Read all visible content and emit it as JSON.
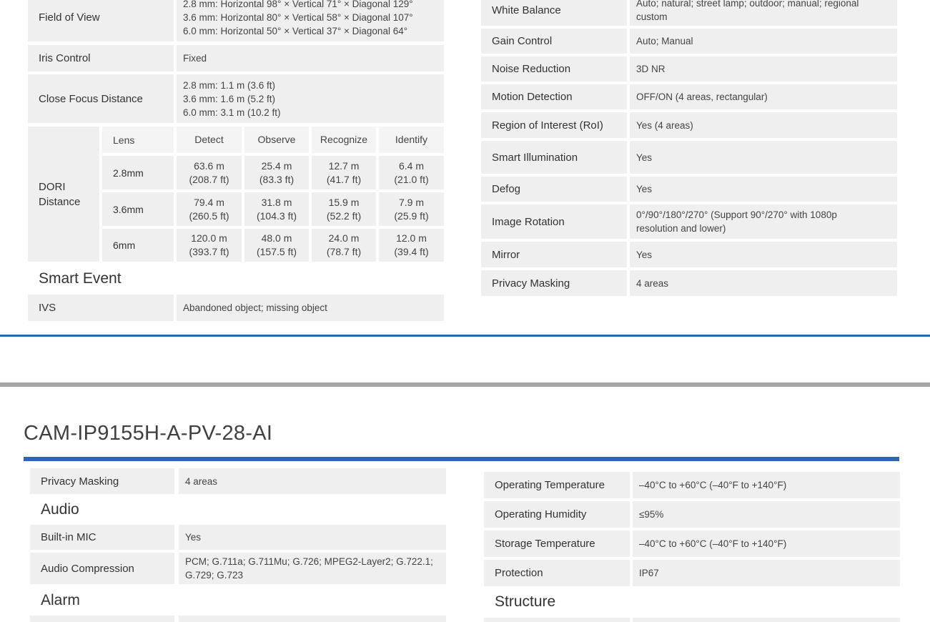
{
  "colors": {
    "accent_blue": "#2c67ad",
    "divider_gray": "#a6a6a6",
    "cell_bg": "#efefef"
  },
  "top_left": {
    "field_of_view": {
      "label": "Field of View",
      "value": "2.8 mm: Horizontal 98° × Vertical 71° × Diagonal 129°\n3.6 mm: Horizontal 80° × Vertical 58° × Diagonal 107°\n6.0 mm: Horizontal 50° × Vertical 37° × Diagonal 64°"
    },
    "iris_control": {
      "label": "Iris Control",
      "value": "Fixed"
    },
    "close_focus": {
      "label": "Close Focus Distance",
      "value": "2.8 mm: 1.1 m (3.6 ft)\n3.6 mm: 1.6 m (5.2 ft)\n6.0 mm: 3.1 m (10.2 ft)"
    },
    "dori": {
      "label": "DORI\nDistance",
      "headers": [
        "Lens",
        "Detect",
        "Observe",
        "Recognize",
        "Identify"
      ],
      "rows": [
        {
          "lens": "2.8mm",
          "cells": [
            "63.6 m\n(208.7 ft)",
            "25.4 m\n(83.3 ft)",
            "12.7 m\n(41.7 ft)",
            "6.4 m\n(21.0 ft)"
          ]
        },
        {
          "lens": "3.6mm",
          "cells": [
            "79.4 m\n(260.5 ft)",
            "31.8 m\n(104.3 ft)",
            "15.9 m\n(52.2 ft)",
            "7.9 m\n(25.9 ft)"
          ]
        },
        {
          "lens": "6mm",
          "cells": [
            "120.0 m\n(393.7 ft)",
            "48.0 m\n(157.5 ft)",
            "24.0 m\n(78.7 ft)",
            "12.0 m\n(39.4 ft)"
          ]
        }
      ]
    },
    "smart_event_title": "Smart Event",
    "ivs": {
      "label": "IVS",
      "value": "Abandoned object; missing object"
    }
  },
  "top_right": {
    "rows": [
      {
        "label": "White Balance",
        "value": "Auto; natural; street lamp; outdoor; manual; regional\ncustom"
      },
      {
        "label": "Gain Control",
        "value": "Auto; Manual"
      },
      {
        "label": "Noise Reduction",
        "value": "3D NR"
      },
      {
        "label": "Motion Detection",
        "value": "OFF/ON (4 areas, rectangular)"
      },
      {
        "label": "Region of Interest (RoI)",
        "value": "Yes (4 areas)"
      },
      {
        "label": "Smart Illumination",
        "value": "Yes"
      },
      {
        "label": "Defog",
        "value": "Yes"
      },
      {
        "label": "Image Rotation",
        "value": "0°/90°/180°/270° (Support 90°/270° with 1080p\nresolution and lower)"
      },
      {
        "label": "Mirror",
        "value": "Yes"
      },
      {
        "label": "Privacy Masking",
        "value": "4 areas"
      }
    ]
  },
  "bottom": {
    "model_title": "CAM-IP9155H-A-PV-28-AI",
    "left": {
      "privacy_masking": {
        "label": "Privacy Masking",
        "value": "4 areas"
      },
      "audio_title": "Audio",
      "builtin_mic": {
        "label": "Built-in MIC",
        "value": "Yes"
      },
      "audio_compression": {
        "label": "Audio Compression",
        "value": "PCM; G.711a; G.711Mu; G.726; MPEG2-Layer2; G.722.1;\nG.729; G.723"
      },
      "alarm_title": "Alarm"
    },
    "right": {
      "rows": [
        {
          "label": "Operating Temperature",
          "value": "–40°C to +60°C (–40°F to +140°F)"
        },
        {
          "label": "Operating Humidity",
          "value": "≤95%"
        },
        {
          "label": "Storage Temperature",
          "value": "–40°C to +60°C (–40°F to +140°F)"
        },
        {
          "label": "Protection",
          "value": "IP67"
        }
      ],
      "structure_title": "Structure"
    }
  }
}
